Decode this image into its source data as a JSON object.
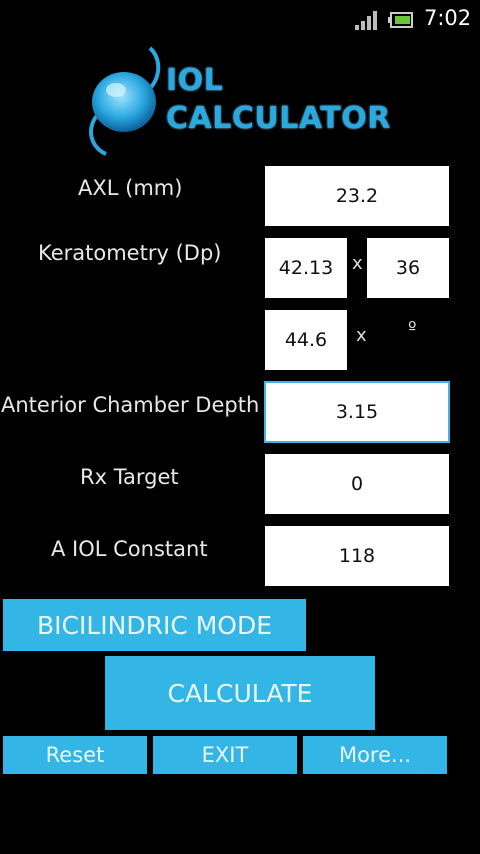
{
  "status_bar": {
    "time": "7:02"
  },
  "logo": {
    "line1": "IOL",
    "line2": "CALCULATOR"
  },
  "form": {
    "axl": {
      "label": "AXL (mm)",
      "value": "23.2"
    },
    "keratometry": {
      "label": "Keratometry (Dp)",
      "k1": "42.13",
      "k1_axis": "36",
      "k2": "44.6",
      "k2_axis_unit": "º",
      "separator": "x"
    },
    "acd": {
      "label": "Anterior Chamber Depth",
      "value": "3.15"
    },
    "rx_target": {
      "label": "Rx Target",
      "value": "0"
    },
    "a_constant": {
      "label": "A IOL Constant",
      "value": "118"
    }
  },
  "buttons": {
    "bicilindric": "BICILINDRIC MODE",
    "calculate": "CALCULATE",
    "reset": "Reset",
    "exit": "EXIT",
    "more": "More..."
  },
  "colors": {
    "accent": "#33b5e5",
    "background": "#000000",
    "field": "#ffffff"
  }
}
